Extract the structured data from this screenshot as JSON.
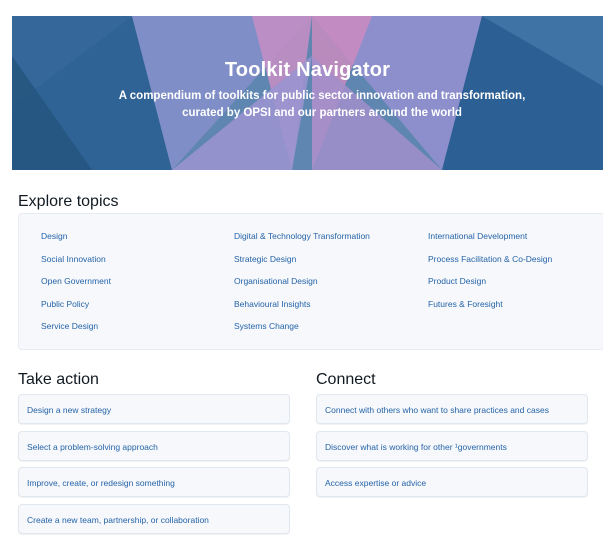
{
  "hero": {
    "title": "Toolkit Navigator",
    "subtitle_line1": "A compendium of toolkits for public sector innovation and transformation,",
    "subtitle_line2": "curated by OPSI and our partners around the world"
  },
  "explore": {
    "heading": "Explore topics",
    "columns": [
      [
        "Design",
        "Social Innovation",
        "Open Government",
        "Public Policy",
        "Service Design"
      ],
      [
        "Digital & Technology Transformation",
        "Strategic Design",
        "Organisational Design",
        "Behavioural Insights",
        "Systems Change"
      ],
      [
        "International Development",
        "Process Facilitation & Co-Design",
        "Product Design",
        "Futures & Foresight"
      ]
    ]
  },
  "take_action": {
    "heading": "Take action",
    "items": [
      "Design a new strategy",
      "Select a problem-solving approach",
      "Improve, create, or redesign something",
      "Create a new team, partnership, or collaboration"
    ]
  },
  "connect": {
    "heading": "Connect",
    "items": [
      "Connect with others who want to share practices and cases",
      "Discover what is working for other ¹governments",
      "Access expertise or advice"
    ]
  },
  "colors": {
    "hero_base": "#5c7fa8",
    "hero_dark": "#2e5f8f",
    "hero_lavender": "#8f8fc9",
    "hero_pink": "#c98cc4",
    "link": "#2563a8"
  }
}
